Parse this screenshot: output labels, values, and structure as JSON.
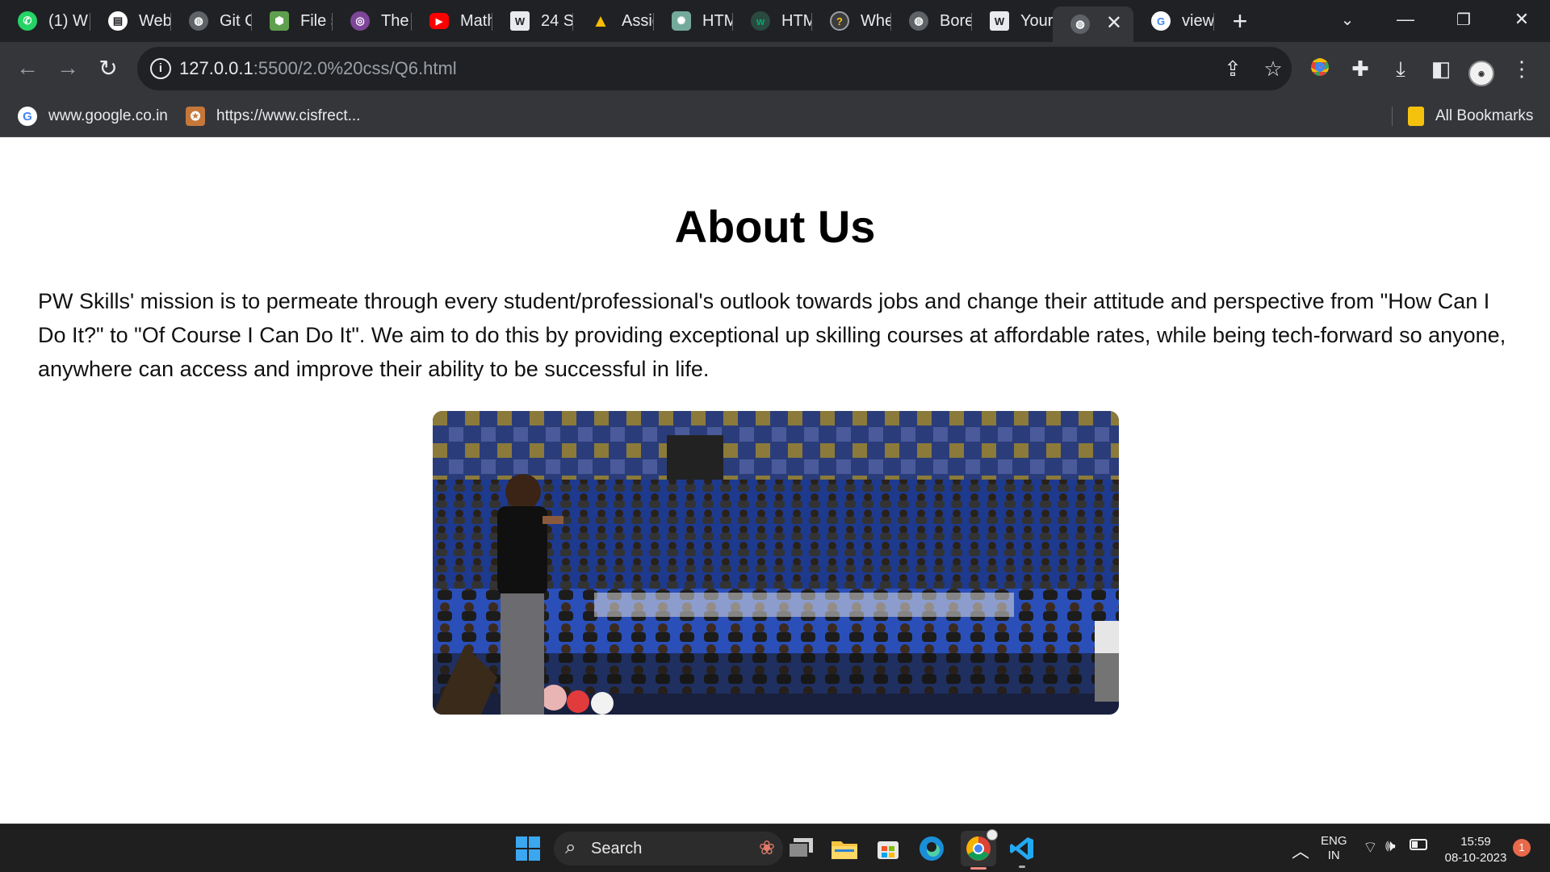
{
  "browser": {
    "tabs": [
      {
        "label": "(1) W",
        "icon": "whatsapp-icon",
        "color": "#25d366"
      },
      {
        "label": "Web",
        "icon": "web-app-icon",
        "color": "#f4c20d"
      },
      {
        "label": "Git C",
        "icon": "globe-icon",
        "color": "#9aa0a6"
      },
      {
        "label": "File s",
        "icon": "nodejs-icon",
        "color": "#5fa04e"
      },
      {
        "label": "The",
        "icon": "tor-icon",
        "color": "#7d4698"
      },
      {
        "label": "Math",
        "icon": "youtube-icon",
        "color": "#ff0000"
      },
      {
        "label": "24 S",
        "icon": "wordpress-icon",
        "color": "#e8eaed"
      },
      {
        "label": "Assig",
        "icon": "google-drive-icon",
        "color": "#1fa463"
      },
      {
        "label": "HTM",
        "icon": "chatgpt-icon",
        "color": "#74aa9c"
      },
      {
        "label": "HTM",
        "icon": "w3schools-icon",
        "color": "#04aa6d"
      },
      {
        "label": "Whe",
        "icon": "question-icon",
        "color": "#9aa0a6"
      },
      {
        "label": "Bore",
        "icon": "globe-icon",
        "color": "#9aa0a6"
      },
      {
        "label": "Your",
        "icon": "wordpress-icon",
        "color": "#e8eaed"
      },
      {
        "label": "",
        "icon": "globe-icon",
        "color": "#9aa0a6",
        "active": true
      },
      {
        "label": "view",
        "icon": "google-icon",
        "color": "#4285f4"
      }
    ],
    "url_host": "127.0.0.1",
    "url_path": ":5500/2.0%20css/Q6.html",
    "bookmarks": [
      {
        "label": "www.google.co.in",
        "icon": "google-icon"
      },
      {
        "label": "https://www.cisfrect...",
        "icon": "cisf-emblem-icon"
      }
    ],
    "all_bookmarks_label": "All Bookmarks"
  },
  "page": {
    "title": "About Us",
    "paragraph": "PW Skills' mission is to permeate through every student/professional's outlook towards jobs and change their attitude and perspective from \"How Can I Do It?\" to \"Of Course I Can Do It\". We aim to do this by providing exceptional up skilling courses at affordable rates, while being tech-forward so anyone, anywhere can access and improve their ability to be successful in life.",
    "image_description": "Speaker addressing a large audience in an auditorium"
  },
  "taskbar": {
    "search_label": "Search",
    "language_top": "ENG",
    "language_bottom": "IN",
    "time": "15:59",
    "date": "08-10-2023",
    "notification_count": "1"
  }
}
